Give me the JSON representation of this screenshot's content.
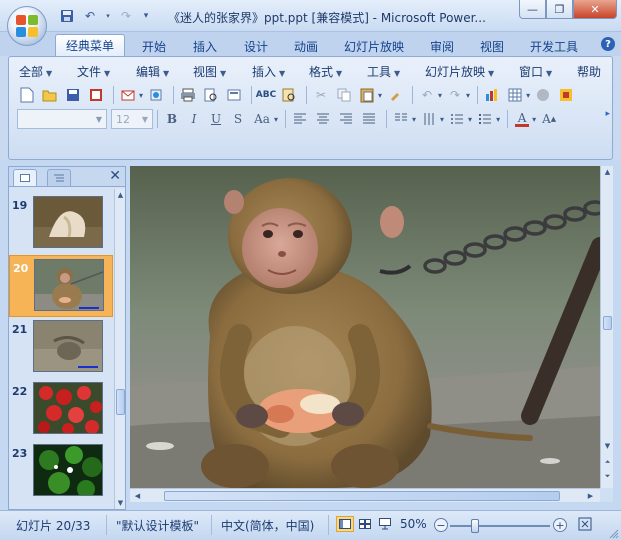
{
  "window": {
    "title": "《迷人的张家界》ppt.ppt [兼容模式] - Microsoft Power...",
    "min_label": "—",
    "max_label": "❐",
    "close_label": "✕"
  },
  "ribbon_tabs": [
    "经典菜单",
    "开始",
    "插入",
    "设计",
    "动画",
    "幻灯片放映",
    "审阅",
    "视图",
    "开发工具"
  ],
  "classic_menu": [
    "全部",
    "文件",
    "编辑",
    "视图",
    "插入",
    "格式",
    "工具",
    "幻灯片放映",
    "窗口",
    "帮助"
  ],
  "toolbar": {
    "font_name": "",
    "font_size": "12",
    "format_buttons": [
      "B",
      "I",
      "U",
      "S",
      "Aa"
    ],
    "font_color_label": "A",
    "grow_font_label": "A"
  },
  "slide_panel": {
    "thumbnails": [
      {
        "num": "19",
        "selected": false
      },
      {
        "num": "20",
        "selected": true
      },
      {
        "num": "21",
        "selected": false
      },
      {
        "num": "22",
        "selected": false
      },
      {
        "num": "23",
        "selected": false
      }
    ]
  },
  "status": {
    "slide_info": "幻灯片 20/33",
    "template": "\"默认设计模板\"",
    "language": "中文(简体，中国)",
    "zoom": "50%",
    "zoom_level_percent": 50
  },
  "colors": {
    "selected_thumb": "#f6b456",
    "accent": "#15428b"
  }
}
